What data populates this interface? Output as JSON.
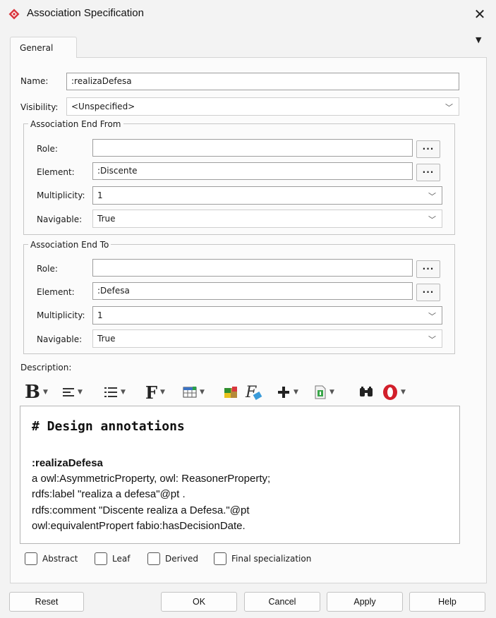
{
  "window": {
    "title": "Association Specification",
    "close_glyph": "✕",
    "overflow_glyph": "▼"
  },
  "tabs": [
    {
      "label": "General",
      "active": true
    }
  ],
  "general": {
    "name_label": "Name:",
    "name_value": ":realizaDefesa",
    "visibility_label": "Visibility:",
    "visibility_value": "<Unspecified>"
  },
  "end_from": {
    "title": "Association End From",
    "role_label": "Role:",
    "role_value": "",
    "element_label": "Element:",
    "element_value": ":Discente",
    "multiplicity_label": "Multiplicity:",
    "multiplicity_value": "1",
    "navigable_label": "Navigable:",
    "navigable_value": "True"
  },
  "end_to": {
    "title": "Association End To",
    "role_label": "Role:",
    "role_value": "",
    "element_label": "Element:",
    "element_value": ":Defesa",
    "multiplicity_label": "Multiplicity:",
    "multiplicity_value": "1",
    "navigable_label": "Navigable:",
    "navigable_value": "True"
  },
  "dots_label": "...",
  "description": {
    "label": "Description:",
    "toolbar_icons": [
      "bold-icon",
      "align-icon",
      "list-icon",
      "font-icon",
      "table-icon",
      "color-icon",
      "formula-icon",
      "insert-icon",
      "document-icon",
      "find-icon",
      "spellcheck-icon"
    ],
    "toolbar_bold_glyph": "B",
    "toolbar_font_glyph": "F",
    "toolbar_formula_glyph": "F",
    "heading": "# Design annotations",
    "lines": [
      ":realizaDefesa",
      "a owl:AsymmetricProperty, owl: ReasonerProperty;",
      "rdfs:label \"realiza a defesa\"@pt .",
      "rdfs:comment \"Discente realiza a Defesa.\"@pt",
      "owl:equivalentPropert fabio:hasDecisionDate."
    ]
  },
  "checkboxes": [
    {
      "label": "Abstract",
      "checked": false
    },
    {
      "label": "Leaf",
      "checked": false
    },
    {
      "label": "Derived",
      "checked": false
    },
    {
      "label": "Final specialization",
      "checked": false
    }
  ],
  "buttons": {
    "reset": "Reset",
    "ok": "OK",
    "cancel": "Cancel",
    "apply": "Apply",
    "help": "Help"
  },
  "colors": {
    "app_icon": "#d9363e",
    "background": "#f3f3f3",
    "panel": "#fbfbfb"
  }
}
